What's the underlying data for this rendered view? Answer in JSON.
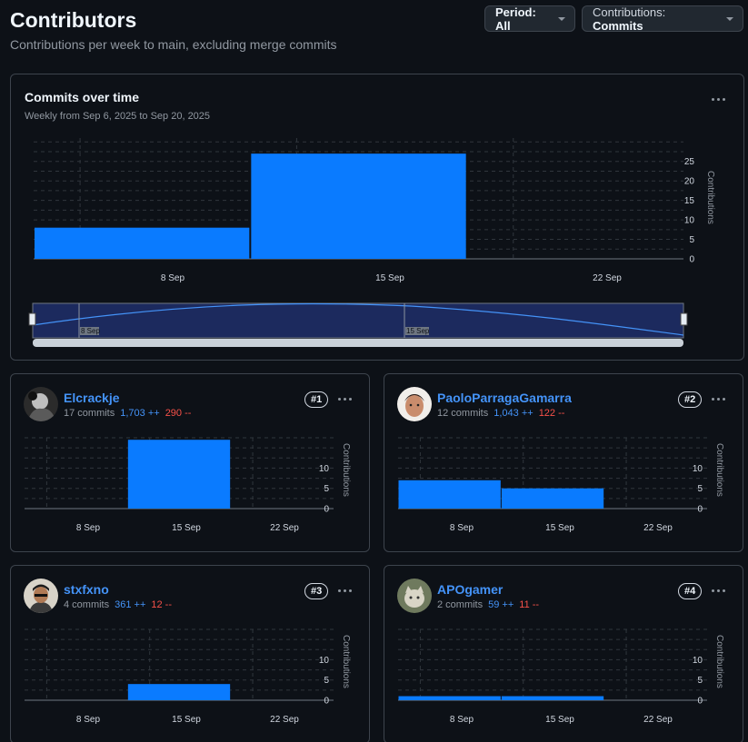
{
  "header": {
    "title": "Contributors",
    "subtitle": "Contributions per week to main, excluding merge commits"
  },
  "controls": {
    "period_prefix": "Period: ",
    "period_value": "All",
    "contrib_prefix": "Contributions: ",
    "contrib_value": "Commits"
  },
  "colors": {
    "bar": "#0a7bff",
    "additions": "#4493f8",
    "deletions": "#f85149",
    "background": "#0d1117"
  },
  "overview": {
    "title": "Commits over time",
    "subtitle": "Weekly from Sep 6, 2025 to Sep 20, 2025",
    "y_label": "Contributions",
    "brush_labels": [
      "8 Sep",
      "15 Sep"
    ]
  },
  "chart_data": [
    {
      "id": "overview",
      "type": "bar",
      "x": [
        "2025-09-06",
        "2025-09-13"
      ],
      "values": [
        8,
        27
      ],
      "ylabel": "Contributions",
      "xticks": [
        "8 Sep",
        "15 Sep",
        "22 Sep"
      ],
      "yticks": [
        0,
        5,
        10,
        15,
        20,
        25
      ],
      "ylim": [
        0,
        31
      ],
      "grid": true
    },
    {
      "id": "Elcrackje",
      "type": "bar",
      "x": [
        "2025-09-13"
      ],
      "values": [
        17
      ],
      "ylabel": "Contributions",
      "xticks": [
        "8 Sep",
        "15 Sep",
        "22 Sep"
      ],
      "yticks": [
        0,
        5,
        10
      ],
      "ylim": [
        0,
        17.5
      ]
    },
    {
      "id": "PaoloParragaGamarra",
      "type": "bar",
      "x": [
        "2025-09-06",
        "2025-09-13"
      ],
      "values": [
        7,
        5
      ],
      "ylabel": "Contributions",
      "xticks": [
        "8 Sep",
        "15 Sep",
        "22 Sep"
      ],
      "yticks": [
        0,
        5,
        10
      ],
      "ylim": [
        0,
        17.5
      ]
    },
    {
      "id": "stxfxno",
      "type": "bar",
      "x": [
        "2025-09-13"
      ],
      "values": [
        4
      ],
      "ylabel": "Contributions",
      "xticks": [
        "8 Sep",
        "15 Sep",
        "22 Sep"
      ],
      "yticks": [
        0,
        5,
        10
      ],
      "ylim": [
        0,
        17.5
      ]
    },
    {
      "id": "APOgamer",
      "type": "bar",
      "x": [
        "2025-09-06",
        "2025-09-13"
      ],
      "values": [
        1,
        1
      ],
      "ylabel": "Contributions",
      "xticks": [
        "8 Sep",
        "15 Sep",
        "22 Sep"
      ],
      "yticks": [
        0,
        5,
        10
      ],
      "ylim": [
        0,
        17.5
      ]
    }
  ],
  "contributors": [
    {
      "name": "Elcrackje",
      "commits": "17 commits",
      "additions": "1,703 ++",
      "deletions": "290 --",
      "rank": "#1",
      "avatar": "avatar-elcrackje"
    },
    {
      "name": "PaoloParragaGamarra",
      "commits": "12 commits",
      "additions": "1,043 ++",
      "deletions": "122 --",
      "rank": "#2",
      "avatar": "avatar-paolo"
    },
    {
      "name": "stxfxno",
      "commits": "4 commits",
      "additions": "361 ++",
      "deletions": "12 --",
      "rank": "#3",
      "avatar": "avatar-stxfxno"
    },
    {
      "name": "APOgamer",
      "commits": "2 commits",
      "additions": "59 ++",
      "deletions": "11 --",
      "rank": "#4",
      "avatar": "avatar-apogamer"
    }
  ]
}
